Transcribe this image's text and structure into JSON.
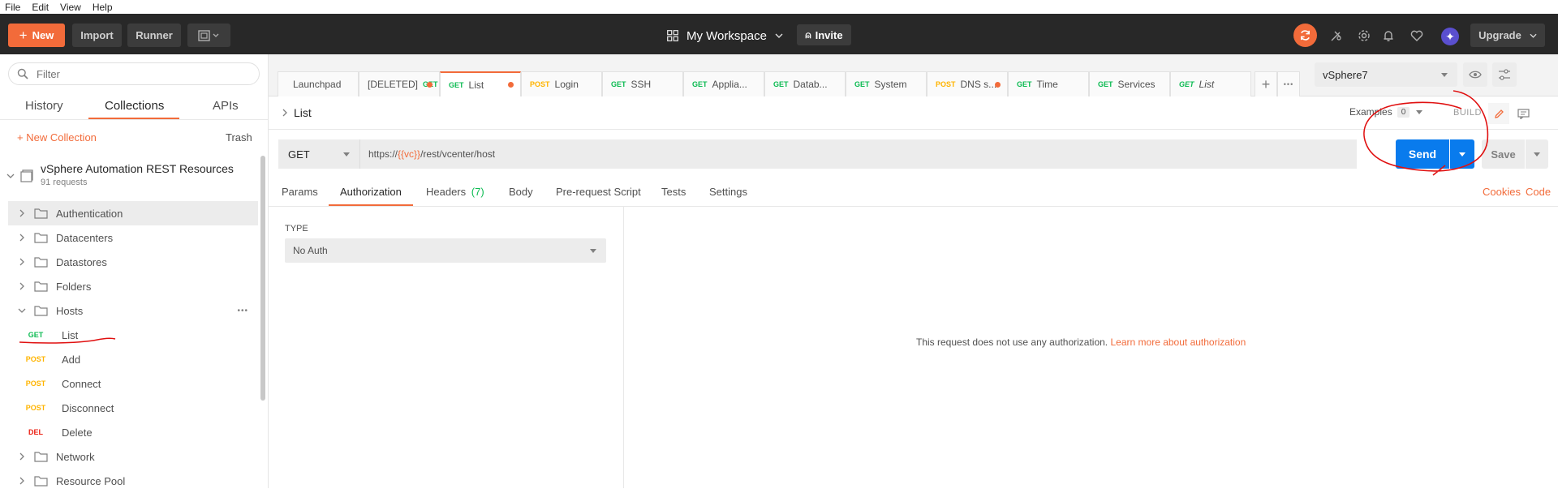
{
  "menu": [
    "File",
    "Edit",
    "View",
    "Help"
  ],
  "header": {
    "new_label": "New",
    "import_label": "Import",
    "runner_label": "Runner",
    "workspace_label": "My Workspace",
    "invite_label": "Invite",
    "upgrade_label": "Upgrade"
  },
  "sidebar": {
    "filter_placeholder": "Filter",
    "tabs": [
      "History",
      "Collections",
      "APIs"
    ],
    "new_collection": "+ New Collection",
    "trash": "Trash",
    "collection": {
      "name": "vSphere Automation REST Resources",
      "count": "91 requests"
    },
    "folders_top": [
      "Authentication",
      "Datacenters",
      "Datastores",
      "Folders",
      "Hosts"
    ],
    "requests": [
      {
        "method": "GET",
        "name": "List"
      },
      {
        "method": "POST",
        "name": "Add"
      },
      {
        "method": "POST",
        "name": "Connect"
      },
      {
        "method": "POST",
        "name": "Disconnect"
      },
      {
        "method": "DEL",
        "name": "Delete"
      }
    ],
    "folders_bottom": [
      "Network",
      "Resource Pool"
    ],
    "more": "•••"
  },
  "tabs": [
    {
      "method": "",
      "name": "Launchpad"
    },
    {
      "method": "",
      "name": "[DELETED]",
      "extra": "GET"
    },
    {
      "method": "GET",
      "name": "List"
    },
    {
      "method": "POST",
      "name": "Login"
    },
    {
      "method": "GET",
      "name": "SSH"
    },
    {
      "method": "GET",
      "name": "Applia..."
    },
    {
      "method": "GET",
      "name": "Datab..."
    },
    {
      "method": "GET",
      "name": "System"
    },
    {
      "method": "POST",
      "name": "DNS s..."
    },
    {
      "method": "GET",
      "name": "Time"
    },
    {
      "method": "GET",
      "name": "Services"
    },
    {
      "method": "GET",
      "name": "List"
    }
  ],
  "tab_more": "•••",
  "environment": "vSphere7",
  "request": {
    "title": "List",
    "examples_label": "Examples",
    "examples_count": "0",
    "build_label": "BUILD",
    "method": "GET",
    "url_prefix": "https://",
    "url_var": "{{vc}}",
    "url_suffix": "/rest/vcenter/host",
    "send_label": "Send",
    "save_label": "Save",
    "subtabs": [
      "Params",
      "Authorization",
      "Headers",
      "Body",
      "Pre-request Script",
      "Tests",
      "Settings"
    ],
    "headers_count": "(7)",
    "cookies": "Cookies",
    "code": "Code",
    "type_label": "TYPE",
    "auth_type": "No Auth",
    "no_auth_msg": "This request does not use any authorization.",
    "learn_more": "Learn more about authorization"
  },
  "colors": {
    "accent": "#f26b3a",
    "send": "#097bed",
    "annotation": "#e01010"
  }
}
